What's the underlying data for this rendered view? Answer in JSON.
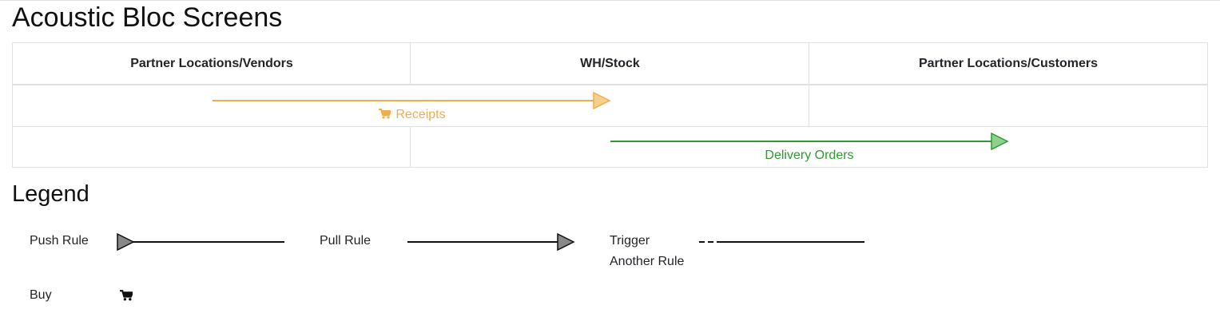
{
  "page": {
    "title": "Acoustic Bloc Screens"
  },
  "route_table": {
    "columns": [
      "Partner Locations/Vendors",
      "WH/Stock",
      "Partner Locations/Customers"
    ],
    "flows": [
      {
        "label": "Receipts",
        "icon": "cart-icon",
        "color": "#f0ad4e",
        "from": "Partner Locations/Vendors",
        "to": "WH/Stock"
      },
      {
        "label": "Delivery Orders",
        "color": "#2f9a2f",
        "from": "WH/Stock",
        "to": "Partner Locations/Customers"
      }
    ]
  },
  "legend": {
    "title": "Legend",
    "items": {
      "push_rule": "Push Rule",
      "pull_rule": "Pull Rule",
      "trigger_line1": "Trigger",
      "trigger_line2": "Another Rule",
      "buy": "Buy"
    }
  }
}
